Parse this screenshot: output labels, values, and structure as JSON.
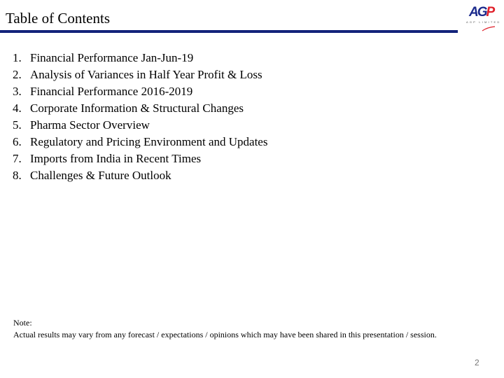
{
  "header": {
    "title": "Table of Contents",
    "bar_color": "#13237a"
  },
  "logo": {
    "text_ag": "AG",
    "text_p": "P",
    "tagline": "AGP LIMITED",
    "colors": {
      "ag": "#1b2a8c",
      "p": "#e0202a"
    }
  },
  "toc": {
    "items": [
      {
        "num": "1.",
        "label": "Financial Performance Jan-Jun-19"
      },
      {
        "num": "2.",
        "label": "Analysis of Variances in Half Year Profit & Loss"
      },
      {
        "num": "3.",
        "label": "Financial Performance 2016-2019"
      },
      {
        "num": "4.",
        "label": "Corporate Information & Structural Changes"
      },
      {
        "num": "5.",
        "label": "Pharma Sector Overview"
      },
      {
        "num": "6.",
        "label": "Regulatory and Pricing Environment and Updates"
      },
      {
        "num": "7.",
        "label": "Imports from India in Recent Times"
      },
      {
        "num": "8.",
        "label": "Challenges & Future Outlook"
      }
    ]
  },
  "note": {
    "heading": "Note:",
    "text": "Actual results may vary from any forecast / expectations / opinions which may have been shared in this presentation / session."
  },
  "footer": {
    "page_number": "2"
  }
}
